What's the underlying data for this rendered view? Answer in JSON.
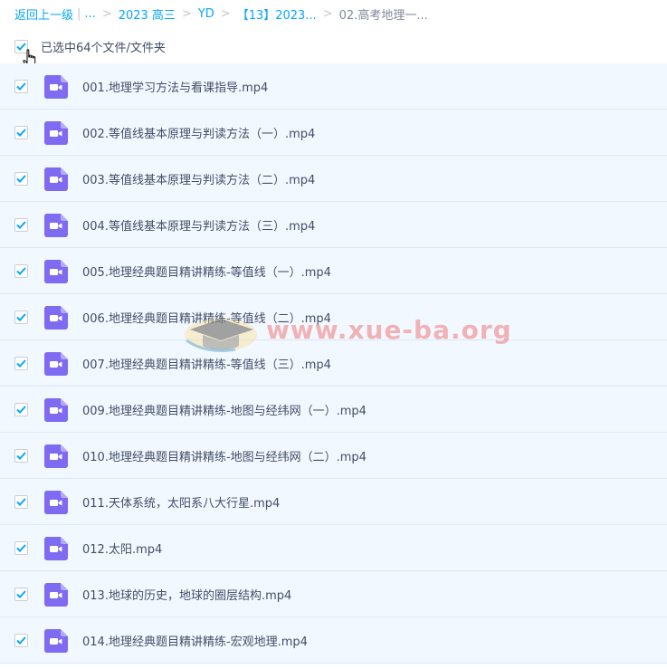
{
  "breadcrumb": {
    "back": "返回上一级",
    "ellipsis": "...",
    "items": [
      "2023 高三",
      "YD",
      "【13】2023..."
    ],
    "current": "02.高考地理一..."
  },
  "selection": {
    "label": "已选中64个文件/文件夹"
  },
  "watermark": {
    "text": "www.xue-ba.org"
  },
  "colors": {
    "accent": "#06a7ff",
    "row_bg": "#f2f8ff",
    "video_icon": "#7e6bf2"
  },
  "files": [
    {
      "name": "001.地理学习方法与看课指导.mp4",
      "icon": "video-file-icon",
      "checked": true
    },
    {
      "name": "002.等值线基本原理与判读方法（一）.mp4",
      "icon": "video-file-icon",
      "checked": true
    },
    {
      "name": "003.等值线基本原理与判读方法（二）.mp4",
      "icon": "video-file-icon",
      "checked": true
    },
    {
      "name": "004.等值线基本原理与判读方法（三）.mp4",
      "icon": "video-file-icon",
      "checked": true
    },
    {
      "name": "005.地理经典题目精讲精练-等值线（一）.mp4",
      "icon": "video-file-icon",
      "checked": true
    },
    {
      "name": "006.地理经典题目精讲精练-等值线（二）.mp4",
      "icon": "video-file-icon",
      "checked": true
    },
    {
      "name": "007.地理经典题目精讲精练-等值线（三）.mp4",
      "icon": "video-file-icon",
      "checked": true
    },
    {
      "name": "009.地理经典题目精讲精练-地图与经纬网（一）.mp4",
      "icon": "video-file-icon",
      "checked": true
    },
    {
      "name": "010.地理经典题目精讲精练-地图与经纬网（二）.mp4",
      "icon": "video-file-icon",
      "checked": true
    },
    {
      "name": "011.天体系统，太阳系八大行星.mp4",
      "icon": "video-file-icon",
      "checked": true
    },
    {
      "name": "012.太阳.mp4",
      "icon": "video-file-icon",
      "checked": true
    },
    {
      "name": "013.地球的历史，地球的圈层结构.mp4",
      "icon": "video-file-icon",
      "checked": true
    },
    {
      "name": "014.地理经典题目精讲精练-宏观地理.mp4",
      "icon": "video-file-icon",
      "checked": true
    }
  ]
}
